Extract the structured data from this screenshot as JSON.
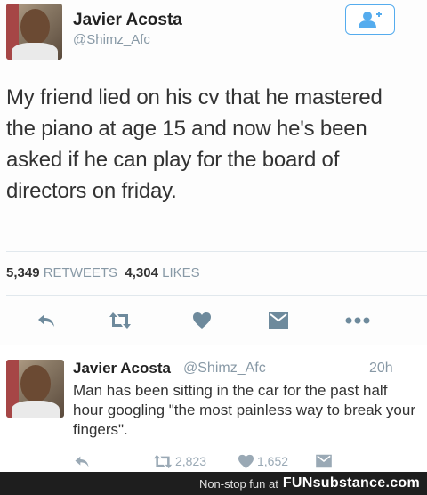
{
  "main_tweet": {
    "author_name": "Javier Acosta",
    "author_handle": "@Shimz_Afc",
    "text": "My friend lied on his cv that he mastered the piano at age 15 and now he's been asked if he can  play for the board of directors on friday.",
    "retweets_count": "5,349",
    "retweets_label": "RETWEETS",
    "likes_count": "4,304",
    "likes_label": "LIKES",
    "actions": [
      "reply-icon",
      "retweet-icon",
      "like-icon",
      "message-icon",
      "more-icon"
    ]
  },
  "reply_tweet": {
    "author_name": "Javier Acosta",
    "author_handle": "@Shimz_Afc",
    "time": "20h",
    "text": "Man has been sitting in the car for the past half hour googling \"the most painless way to break your fingers\".",
    "retweets_count": "2,823",
    "likes_count": "1,652"
  },
  "footer": {
    "tagline": "Non-stop fun at",
    "logo": "FUNsubstance.com"
  },
  "colors": {
    "accent": "#55acee",
    "muted": "#8899a6",
    "icon": "#6e8a9c",
    "footer_bg": "#1e1e1e"
  }
}
